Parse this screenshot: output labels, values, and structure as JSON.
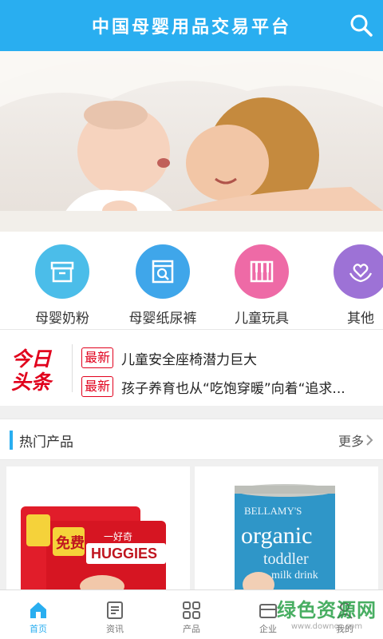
{
  "header": {
    "title": "中国母婴用品交易平台",
    "search_icon": "search-icon"
  },
  "banner": {
    "slides": 3,
    "active_slide": 0
  },
  "categories": [
    {
      "label": "母婴奶粉",
      "icon": "box-icon",
      "color": "#4bbde9"
    },
    {
      "label": "母婴纸尿裤",
      "icon": "package-search-icon",
      "color": "#3fa6ea"
    },
    {
      "label": "儿童玩具",
      "icon": "piano-icon",
      "color": "#ee6aa6"
    },
    {
      "label": "其他",
      "icon": "heart-hands-icon",
      "color": "#9d72d6"
    }
  ],
  "headlines": {
    "logo": [
      "今日",
      "头条"
    ],
    "items": [
      {
        "tag": "最新",
        "text": "儿童安全座椅潜力巨大"
      },
      {
        "tag": "最新",
        "text": "孩子养育也从“吃饱穿暖”向着“追求..."
      }
    ]
  },
  "hot_products": {
    "title": "热门产品",
    "more_label": "更多"
  },
  "products": [
    {
      "brand": "HUGGIES",
      "badge": "免费",
      "extra": "一好奇"
    },
    {
      "brand": "BELLAMY'S",
      "name1": "organic",
      "name2": "toddler",
      "name3": "milk drink"
    }
  ],
  "tabbar": [
    {
      "label": "首页",
      "icon": "home-icon",
      "active": true
    },
    {
      "label": "资讯",
      "icon": "document-icon",
      "active": false
    },
    {
      "label": "产品",
      "icon": "grid-icon",
      "active": false
    },
    {
      "label": "企业",
      "icon": "building-icon",
      "active": false
    },
    {
      "label": "我的",
      "icon": "user-icon",
      "active": false
    }
  ],
  "watermark": {
    "line1": "绿色资源网",
    "line2": "www.downcc.com"
  },
  "colors": {
    "primary": "#29aef0",
    "headline_red": "#e1001c"
  }
}
